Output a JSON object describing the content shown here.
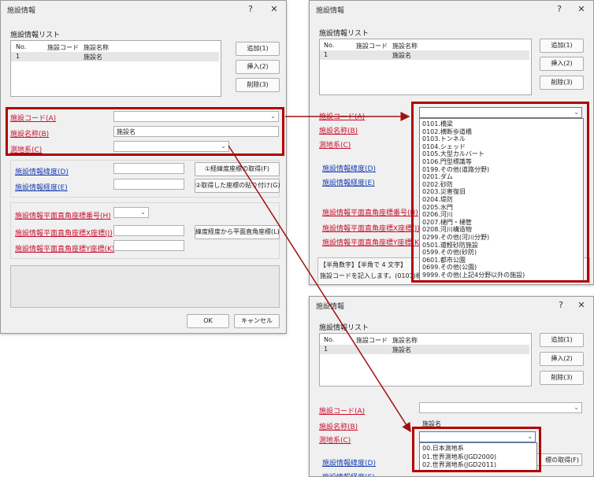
{
  "dialog": {
    "title": "施設情報",
    "help_glyph": "?",
    "close_glyph": "✕",
    "list_label": "施設情報リスト",
    "columns": [
      "No.",
      "施設コード",
      "施設名称"
    ],
    "row": {
      "no": "1",
      "code": "",
      "name": "施設名"
    },
    "add_button": "追加(1)",
    "insert_button": "挿入(2)",
    "delete_button": "削除(3)",
    "code_label": "施設コード(A)",
    "name_label": "施設名称(B)",
    "name_value": "施設名",
    "datum_label": "測地系(C)",
    "lat_label": "施設情報緯度(D)",
    "lon_label": "施設情報経度(E)",
    "get_coords_button": "①経緯度座標の取得(F)",
    "paste_coords_button": "②取得した座標の貼り付け(G)",
    "plane_no_label": "施設情報平面直角座標番号(H)",
    "plane_x_label": "施設情報平面直角座標X座標(J)",
    "plane_y_label": "施設情報平面直角座標Y座標(K)",
    "convert_button": "緯度経度から平面直角座標(L)",
    "ok_button": "OK",
    "cancel_button": "キャンセル"
  },
  "code_dropdown": {
    "options": [
      "0101.橋梁",
      "0102.横断歩道橋",
      "0103.トンネル",
      "0104.シェッド",
      "0105.大型カルバート",
      "0106.門型標識等",
      "0199.その他(道路分野)",
      "0201.ダム",
      "0202.砂防",
      "0203.災害復旧",
      "0204.堤防",
      "0205.水門",
      "0206.河川",
      "0207.樋門・樋管",
      "0208.河川構造物",
      "0299.その他(河川分野)",
      "0501.還輕砂防施設",
      "0599.その他(砂防)",
      "0601.都市公園",
      "0699.その他(公園)",
      "9999.その他(上記4分野以外の施設)"
    ],
    "hint_line1": "【半角数字】【半角で 4 文字】",
    "hint_line2": "施設コードを記入します。(0101)橋梁"
  },
  "datum_dropdown": {
    "options": [
      "00.日本測地系",
      "01.世界測地系(JGD2000)",
      "02.世界測地系(JGD2011)"
    ]
  },
  "colors": {
    "highlight": "#b30000",
    "arrow": "#a01010",
    "required_label": "#c8102e",
    "optional_label": "#1a3fb0"
  }
}
